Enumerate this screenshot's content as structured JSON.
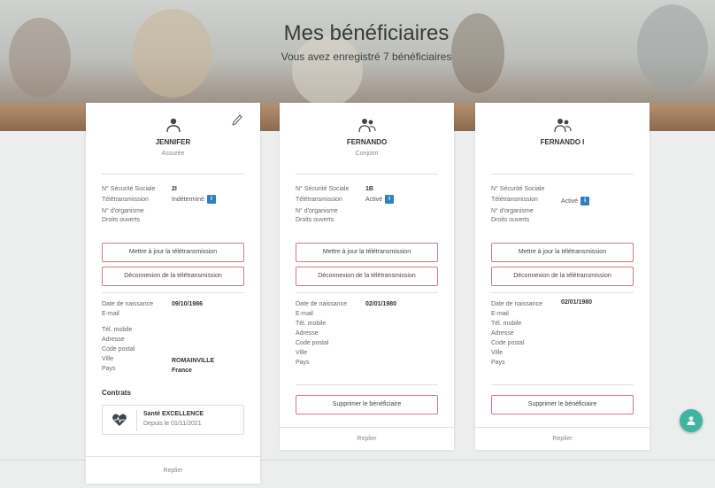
{
  "header": {
    "title": "Mes bénéficiaires",
    "subtitle": "Vous avez enregistré 7 bénéficiaires"
  },
  "labels": {
    "secu": "N° Sécurité Sociale",
    "teletrans": "Télétransmission",
    "organisme": "N° d'organisme",
    "droits": "Droits ouverts",
    "update_btn": "Mettre à jour la télétransmission",
    "disconnect_btn": "Déconnexion de la télétransmission",
    "birth": "Date de naissance",
    "email": "E-mail",
    "tel": "Tél. mobile",
    "address": "Adresse",
    "postal": "Code postal",
    "city": "Ville",
    "country": "Pays",
    "contracts": "Contrats",
    "delete_btn": "Supprimer le bénéficiaire",
    "fold": "Replier"
  },
  "cards": [
    {
      "name": "JENNIFER",
      "role": "Assurée",
      "secu": "2I",
      "teletrans": "Indéterminé",
      "birth": "09/10/1986",
      "city": "ROMAINVILLE",
      "country": "France",
      "contract": {
        "name": "Santé EXCELLENCE",
        "since": "Depuis le 01/11/2021"
      }
    },
    {
      "name": "FERNANDO",
      "role": "Conjoint",
      "secu": "1B",
      "teletrans": "Activé",
      "birth": "02/01/1980"
    },
    {
      "name": "FERNANDO I",
      "role": "",
      "secu": "",
      "teletrans": "Activé",
      "birth": "02/01/1980"
    }
  ],
  "colors": {
    "accent_teal": "#3fb59f",
    "info_blue": "#2f7fc1",
    "button_border": "#c97c84"
  }
}
